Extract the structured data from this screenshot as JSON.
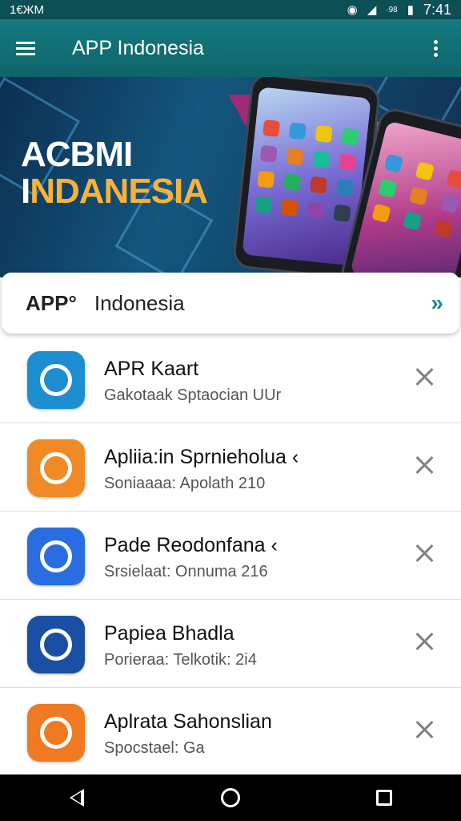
{
  "status_bar": {
    "left_text": "1€ЖМ",
    "right_small": "·98",
    "time": "7:41",
    "icons": [
      "wifi-icon",
      "signal-icon",
      "battery-icon"
    ]
  },
  "app_bar": {
    "title": "APP Indonesia",
    "icons": [
      "menu-icon",
      "more-vertical-icon"
    ]
  },
  "banner": {
    "line1": "ACBMI",
    "line2_first": "I",
    "line2_rest": "NDANESIA"
  },
  "header_card": {
    "bold": "APP°",
    "text": "Indonesia",
    "arrow": "»"
  },
  "apps": [
    {
      "name": "APR Kaart",
      "sub": "Gakotaak  Sptaocian UUr",
      "color": "#1e8ed2"
    },
    {
      "name": "Apliia:in Sprnieholua ‹",
      "sub": "Soniaaaa:  Apolath     210",
      "color": "#f08a26"
    },
    {
      "name": "Pade Reodonfana ‹",
      "sub": "Srsielaat:  Onnuma     216",
      "color": "#2a6de0"
    },
    {
      "name": "Papiea Bhadla",
      "sub": "Porieraa:  Telkotik:     2i4",
      "color": "#1b4fa3"
    },
    {
      "name": "Aplrata Sahonslian",
      "sub": "Spocstael:  Ga",
      "color": "#ef7a22"
    }
  ],
  "colors": {
    "app_bar": "#157a80",
    "status_bar": "#0c4f55",
    "accent": "#1f8b8d",
    "banner_highlight": "#f6b23b"
  }
}
